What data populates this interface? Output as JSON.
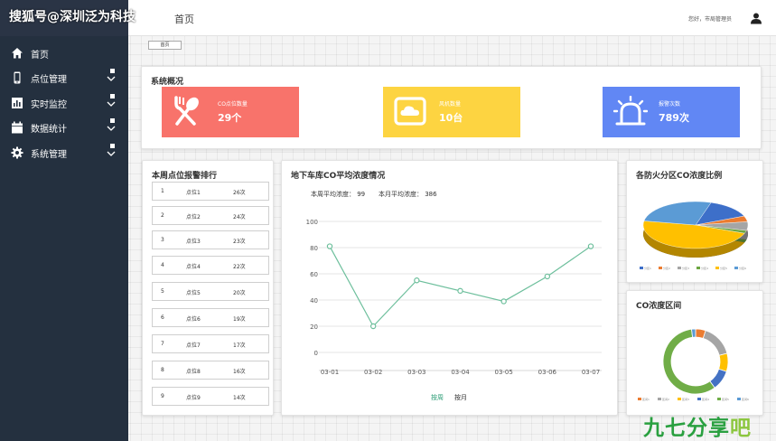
{
  "watermark": "搜狐号@深圳泛为科技",
  "header": {
    "title": "首页",
    "greeting": "您好，市局管理员",
    "user_icon": "user-icon"
  },
  "sidebar": {
    "items": [
      {
        "label": "首页",
        "icon": "home-icon"
      },
      {
        "label": "点位管理",
        "icon": "phone-icon"
      },
      {
        "label": "实时监控",
        "icon": "bar-chart-icon"
      },
      {
        "label": "数据统计",
        "icon": "calendar-icon"
      },
      {
        "label": "系统管理",
        "icon": "gear-icon"
      }
    ]
  },
  "breadcrumb": {
    "label": "首页"
  },
  "overview": {
    "title": "系统概况",
    "cards": [
      {
        "label": "CO点位数量",
        "value": "29个",
        "color": "#f8736b",
        "icon": "utensils-icon"
      },
      {
        "label": "风机数量",
        "value": "10台",
        "color": "#fdd441",
        "icon": "cloud-monitor-icon"
      },
      {
        "label": "报警次数",
        "value": "789次",
        "color": "#6187f4",
        "icon": "alarm-light-icon"
      }
    ]
  },
  "ranking": {
    "title": "本周点位报警排行",
    "rows": [
      {
        "index": "1",
        "name": "点位1",
        "count": "26次"
      },
      {
        "index": "2",
        "name": "点位2",
        "count": "24次"
      },
      {
        "index": "3",
        "name": "点位3",
        "count": "23次"
      },
      {
        "index": "4",
        "name": "点位4",
        "count": "22次"
      },
      {
        "index": "5",
        "name": "点位5",
        "count": "20次"
      },
      {
        "index": "6",
        "name": "点位6",
        "count": "19次"
      },
      {
        "index": "7",
        "name": "点位7",
        "count": "17次"
      },
      {
        "index": "8",
        "name": "点位8",
        "count": "16次"
      },
      {
        "index": "9",
        "name": "点位9",
        "count": "14次"
      }
    ]
  },
  "line_panel": {
    "title": "地下车库CO平均浓度情况",
    "week_avg": "本周平均浓度： 99",
    "month_avg": "本月平均浓度： 386",
    "tabs": [
      {
        "label": "按周",
        "active": true,
        "color": "#2e9e77"
      },
      {
        "label": "按月",
        "active": false,
        "color": "#333333"
      }
    ]
  },
  "pie_panel": {
    "title": "各防火分区CO浓度比例"
  },
  "donut_panel": {
    "title": "CO浓度区间"
  },
  "chart_data": [
    {
      "type": "line",
      "title": "",
      "x": [
        "03-01",
        "03-02",
        "03-03",
        "03-04",
        "03-05",
        "03-06",
        "03-07"
      ],
      "series": [
        {
          "values": [
            81,
            20,
            55,
            47,
            39,
            58,
            81
          ],
          "color": "#6dbf9c"
        }
      ],
      "ylim": [
        0,
        100
      ],
      "yticks": [
        0,
        20,
        40,
        60,
        80,
        100
      ],
      "grid": true
    },
    {
      "type": "pie",
      "title": "",
      "values": [
        14,
        4,
        6,
        2,
        47,
        27
      ],
      "colors": [
        "#3d6fc9",
        "#eb7c31",
        "#a5a5a5",
        "#6ca641",
        "#ffc000",
        "#5b9bd5"
      ],
      "legend": [
        "分区1",
        "分区2",
        "分区3",
        "分区4",
        "分区5",
        "分区6"
      ],
      "legend_position": "bottom"
    },
    {
      "type": "pie",
      "title": "",
      "values": [
        5,
        16,
        9,
        10,
        58,
        2
      ],
      "colors": [
        "#eb7c31",
        "#a5a5a5",
        "#ffc000",
        "#4472c4",
        "#70ad47",
        "#5b9bd5"
      ],
      "legend": [
        "区间1",
        "区间2",
        "区间3",
        "区间4",
        "区间5",
        "区间6"
      ],
      "legend_position": "bottom"
    }
  ],
  "bottom_logo": {
    "text_main": "九七分享",
    "text_accent": "吧"
  }
}
